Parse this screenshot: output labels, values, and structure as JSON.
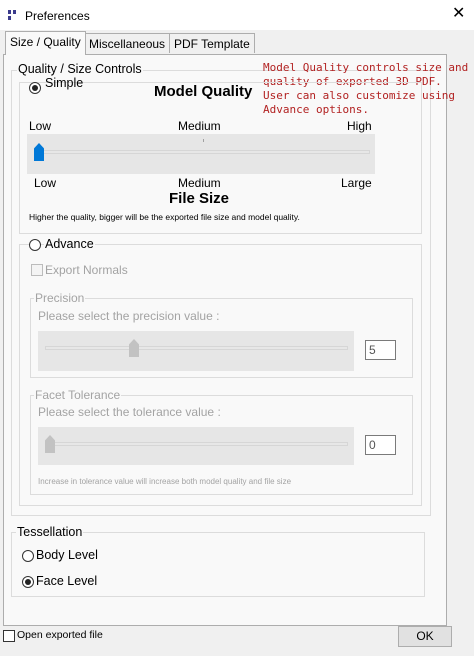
{
  "window": {
    "title": "Preferences",
    "close_glyph": "✕"
  },
  "tabs": [
    {
      "label": "Size / Quality",
      "active": true
    },
    {
      "label": "Miscellaneous",
      "active": false
    },
    {
      "label": "PDF Template",
      "active": false
    }
  ],
  "quality_group": {
    "legend": "Quality / Size Controls",
    "note": "Model Quality controls size and\nquality of exported 3D PDF.\nUser can also customize using\nAdvance options.",
    "note_color": "#b22222",
    "simple": {
      "label": "Simple",
      "selected": true,
      "model_quality_heading": "Model Quality",
      "quality_labels": [
        "Low",
        "Medium",
        "High"
      ],
      "size_labels": [
        "Low",
        "Medium",
        "Large"
      ],
      "file_size_heading": "File Size",
      "slider_level": 0,
      "thumb_color": "#0078d7",
      "footnote": "Higher the quality, bigger will be the exported file size and model quality."
    },
    "advance": {
      "label": "Advance",
      "selected": false,
      "export_normals_label": "Export Normals",
      "precision": {
        "legend": "Precision",
        "prompt": "Please select the precision value :",
        "value": "5"
      },
      "facet_tolerance": {
        "legend": "Facet Tolerance",
        "prompt": "Please select the tolerance value :",
        "value": "0",
        "footnote": "Increase in tolerance value will increase both model quality and file size"
      }
    }
  },
  "tessellation": {
    "legend": "Tessellation",
    "options": [
      {
        "label": "Body Level",
        "selected": false
      },
      {
        "label": "Face Level",
        "selected": true
      }
    ]
  },
  "footer": {
    "open_exported_label": "Open exported file",
    "open_exported_checked": false,
    "ok_label": "OK"
  }
}
